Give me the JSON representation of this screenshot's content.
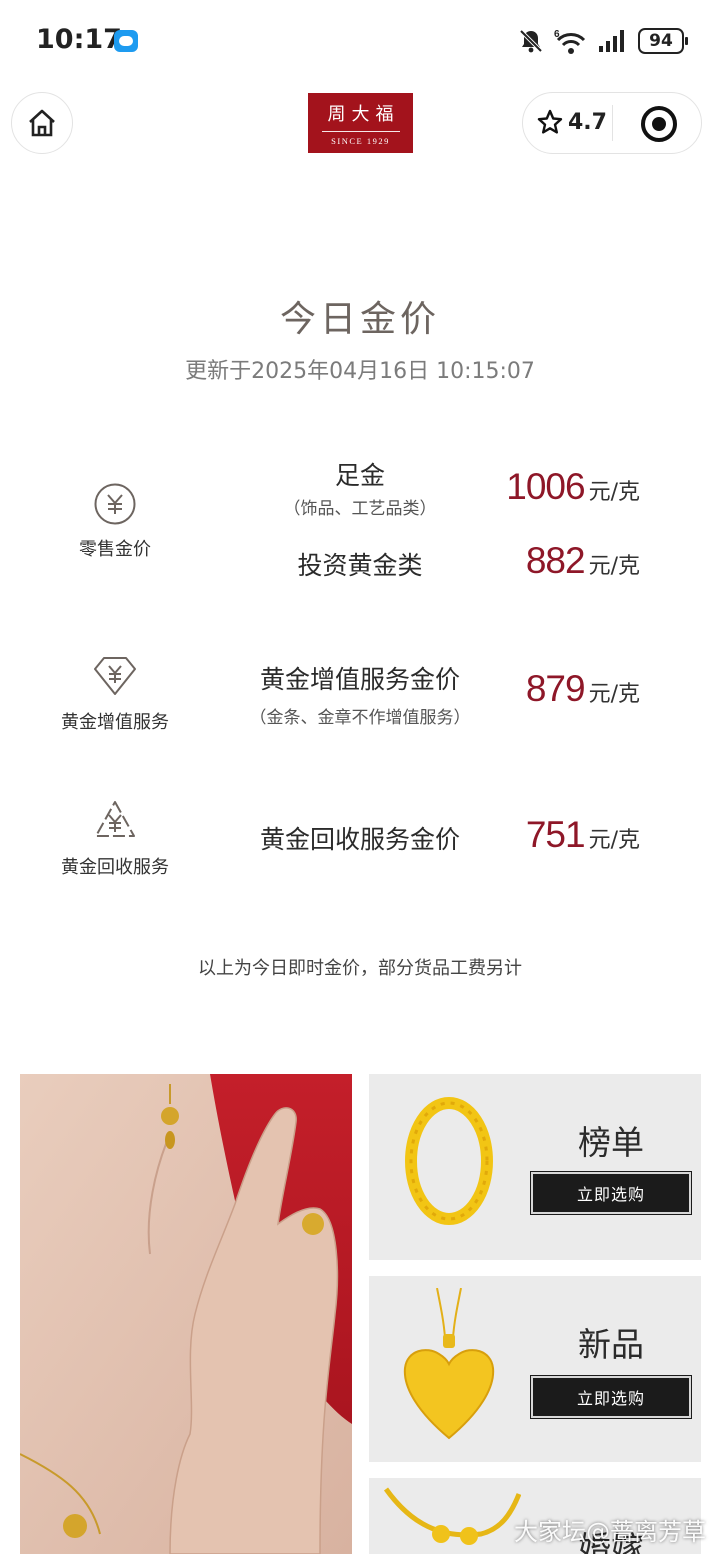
{
  "status_bar": {
    "time": "10:17",
    "battery": "94",
    "network_label": "6"
  },
  "nav": {
    "logo_text": "周大福",
    "logo_sub": "SINCE 1929",
    "rating": "4.7"
  },
  "gold_price": {
    "title": "今日金价",
    "updated": "更新于2025年04月16日 10:15:07",
    "categories": [
      {
        "label": "零售金价",
        "icon": "yuan-circle-icon",
        "items": [
          {
            "name": "足金",
            "sub": "（饰品、工艺品类）",
            "price": "1006",
            "unit": "元/克"
          },
          {
            "name": "投资黄金类",
            "sub": "",
            "price": "882",
            "unit": "元/克"
          }
        ]
      },
      {
        "label": "黄金增值服务",
        "icon": "yuan-diamond-icon",
        "items": [
          {
            "name": "黄金增值服务金价",
            "sub": "（金条、金章不作增值服务）",
            "price": "879",
            "unit": "元/克"
          }
        ]
      },
      {
        "label": "黄金回收服务",
        "icon": "yuan-recycle-icon",
        "items": [
          {
            "name": "黄金回收服务金价",
            "sub": "",
            "price": "751",
            "unit": "元/克"
          }
        ]
      }
    ],
    "note": "以上为今日即时金价，部分货品工费另计"
  },
  "promo": {
    "cards": [
      {
        "title": "榜单",
        "button": "立即选购"
      },
      {
        "title": "新品",
        "button": "立即选购"
      },
      {
        "title": "婚嫁"
      }
    ]
  },
  "watermark": "大家坛@蔷离芳草",
  "colors": {
    "brand_red": "#a3131c",
    "price_red": "#8e1728",
    "title_gray": "#6d6560"
  }
}
